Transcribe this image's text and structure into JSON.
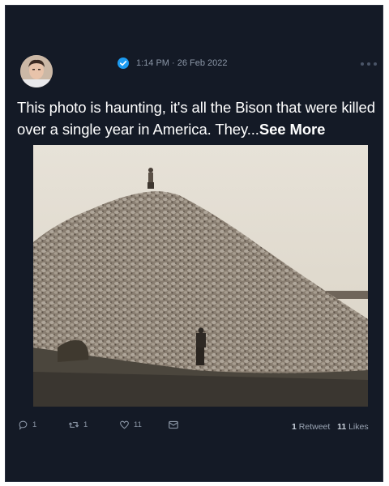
{
  "tweet": {
    "timestamp": "1:14 PM · 26 Feb 2022",
    "text": "This photo is haunting, it's all the Bison that were killed over a single year in America. They...",
    "see_more_label": "See More",
    "verified": true
  },
  "actions": {
    "reply_count": "1",
    "retweet_count": "1",
    "like_count": "11"
  },
  "stats": {
    "retweets_value": "1",
    "retweets_label": "Retweet",
    "likes_value": "11",
    "likes_label": "Likes"
  },
  "colors": {
    "background": "#141a26",
    "text": "#ffffff",
    "muted": "#8b96a6",
    "verified": "#1d9bf0"
  }
}
